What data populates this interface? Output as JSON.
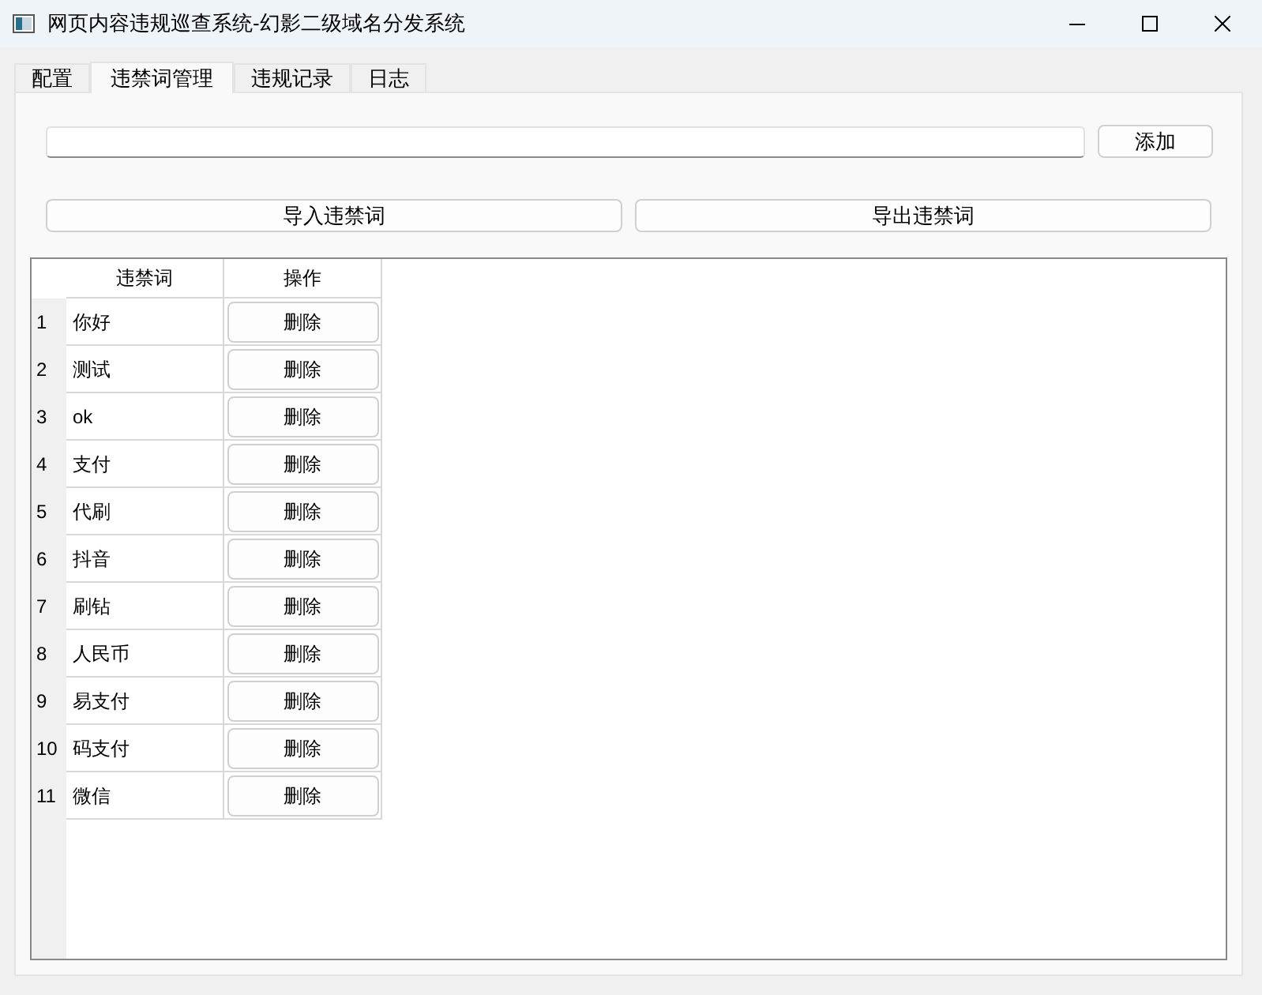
{
  "window": {
    "title": "网页内容违规巡查系统-幻影二级域名分发系统"
  },
  "tabs": [
    {
      "label": "配置",
      "selected": false
    },
    {
      "label": "违禁词管理",
      "selected": true
    },
    {
      "label": "违规记录",
      "selected": false
    },
    {
      "label": "日志",
      "selected": false
    }
  ],
  "add_button": "添加",
  "import_button": "导入违禁词",
  "export_button": "导出违禁词",
  "table": {
    "columns": [
      "违禁词",
      "操作"
    ],
    "rows": [
      {
        "number": "1",
        "word": "你好",
        "action": "删除"
      },
      {
        "number": "2",
        "word": "测试",
        "action": "删除"
      },
      {
        "number": "3",
        "word": "ok",
        "action": "删除"
      },
      {
        "number": "4",
        "word": "支付",
        "action": "删除"
      },
      {
        "number": "5",
        "word": "代刷",
        "action": "删除"
      },
      {
        "number": "6",
        "word": "抖音",
        "action": "删除"
      },
      {
        "number": "7",
        "word": "刷钻",
        "action": "删除"
      },
      {
        "number": "8",
        "word": "人民币",
        "action": "删除"
      },
      {
        "number": "9",
        "word": "易支付",
        "action": "删除"
      },
      {
        "number": "10",
        "word": "码支付",
        "action": "删除"
      },
      {
        "number": "11",
        "word": "微信",
        "action": "删除"
      }
    ]
  }
}
